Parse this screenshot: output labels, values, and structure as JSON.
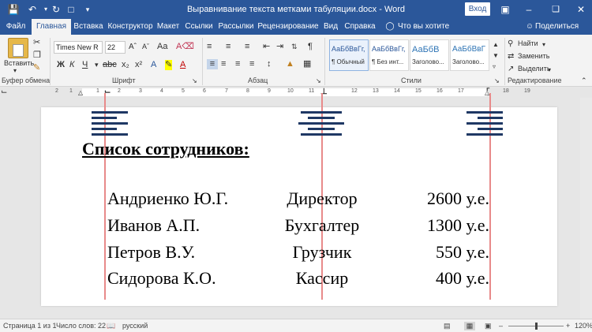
{
  "window": {
    "title": "Выравнивание текста метками табуляции.docx  -  Word",
    "login_label": "Вход"
  },
  "menu": {
    "tabs": [
      "Файл",
      "Главная",
      "Вставка",
      "Конструктор",
      "Макет",
      "Ссылки",
      "Рассылки",
      "Рецензирование",
      "Вид",
      "Справка"
    ],
    "tell_me": "Что вы хотите сделать?",
    "share": "Поделиться"
  },
  "ribbon": {
    "paste_label": "Вставить",
    "font_name": "Times New R",
    "font_size": "22",
    "groups": {
      "clipboard": "Буфер обмена",
      "font": "Шрифт",
      "paragraph": "Абзац",
      "styles": "Стили",
      "editing": "Редактирование"
    },
    "styles": [
      {
        "sample": "АаБбВвГг,",
        "name": "¶ Обычный"
      },
      {
        "sample": "АаБбВвГг,",
        "name": "¶ Без инт..."
      },
      {
        "sample": "АаБбВ",
        "name": "Заголово..."
      },
      {
        "sample": "АаБбВвГ",
        "name": "Заголово..."
      }
    ],
    "editing": {
      "find": "Найти",
      "replace": "Заменить",
      "select": "Выделить"
    }
  },
  "ruler": {
    "numbers": [
      "2",
      "1",
      "1",
      "2",
      "3",
      "4",
      "5",
      "6",
      "7",
      "8",
      "9",
      "10",
      "11",
      "12",
      "13",
      "14",
      "15",
      "16",
      "17",
      "18",
      "19"
    ]
  },
  "document": {
    "heading": "Список сотрудников:",
    "rows": [
      {
        "name": "Андриенко Ю.Г.",
        "position": "Директор",
        "salary": "2600 у.е."
      },
      {
        "name": "Иванов А.П.",
        "position": "Бухгалтер",
        "salary": "1300 у.е."
      },
      {
        "name": "Петров В.У.",
        "position": "Грузчик",
        "salary": "550 у.е."
      },
      {
        "name": "Сидорова К.О.",
        "position": "Кассир",
        "salary": "400 у.е."
      }
    ]
  },
  "status": {
    "page": "Страница 1 из 1",
    "words": "Число слов: 22",
    "language": "русский",
    "zoom": "120%"
  },
  "colors": {
    "accent": "#2b579a",
    "tab_marker": "#1f3864",
    "tab_line": "#e88a8a"
  }
}
